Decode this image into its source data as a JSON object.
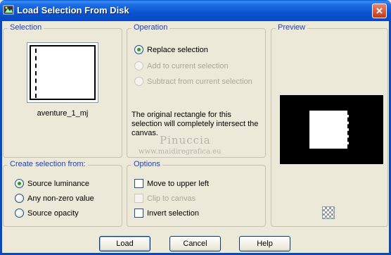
{
  "window": {
    "title": "Load Selection From Disk",
    "close_glyph": "✕"
  },
  "selection": {
    "label": "Selection",
    "filename": "aventure_1_mj"
  },
  "operation": {
    "label": "Operation",
    "options": [
      {
        "label": "Replace selection",
        "checked": true,
        "enabled": true
      },
      {
        "label": "Add to current selection",
        "checked": false,
        "enabled": false
      },
      {
        "label": "Subtract from current selection",
        "checked": false,
        "enabled": false
      }
    ],
    "note": "The original rectangle for this selection will completely intersect the canvas."
  },
  "preview": {
    "label": "Preview",
    "transparency_icon": "checkerboard-icon"
  },
  "create_from": {
    "label": "Create selection from:",
    "options": [
      {
        "label": "Source luminance",
        "checked": true
      },
      {
        "label": "Any non-zero value",
        "checked": false
      },
      {
        "label": "Source opacity",
        "checked": false
      }
    ]
  },
  "options": {
    "label": "Options",
    "items": [
      {
        "label": "Move to upper left",
        "checked": false,
        "enabled": true
      },
      {
        "label": "Clip to canvas",
        "checked": false,
        "enabled": false
      },
      {
        "label": "Invert selection",
        "checked": false,
        "enabled": true
      }
    ]
  },
  "watermark": {
    "name": "Pinuccia",
    "url": "www.maidiregrafica.eu"
  },
  "buttons": {
    "load": "Load",
    "cancel": "Cancel",
    "help": "Help"
  },
  "colors": {
    "title_bar": "#0a54d0",
    "group_label": "#1f3fbd",
    "dialog_bg": "#ece9d8"
  }
}
